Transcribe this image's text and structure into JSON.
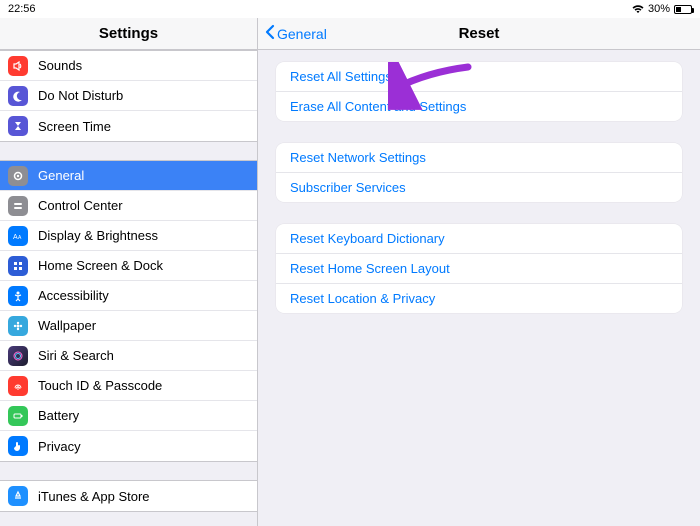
{
  "status": {
    "time": "22:56",
    "battery_pct": "30%"
  },
  "sidebar": {
    "title": "Settings",
    "group1": [
      {
        "label": "Sounds",
        "icon": "sounds",
        "bg": "#ff3b30"
      },
      {
        "label": "Do Not Disturb",
        "icon": "dnd",
        "bg": "#5856d6"
      },
      {
        "label": "Screen Time",
        "icon": "screentime",
        "bg": "#5856d6"
      }
    ],
    "group2": [
      {
        "label": "General",
        "icon": "general",
        "bg": "#8e8e93",
        "selected": true
      },
      {
        "label": "Control Center",
        "icon": "controlcenter",
        "bg": "#8e8e93"
      },
      {
        "label": "Display & Brightness",
        "icon": "display",
        "bg": "#007aff"
      },
      {
        "label": "Home Screen & Dock",
        "icon": "homescreen",
        "bg": "#2d5dd6"
      },
      {
        "label": "Accessibility",
        "icon": "accessibility",
        "bg": "#007aff"
      },
      {
        "label": "Wallpaper",
        "icon": "wallpaper",
        "bg": "#36a8de"
      },
      {
        "label": "Siri & Search",
        "icon": "siri",
        "bg": "#1c1c2e"
      },
      {
        "label": "Touch ID & Passcode",
        "icon": "touchid",
        "bg": "#ff3b30"
      },
      {
        "label": "Battery",
        "icon": "battery",
        "bg": "#34c759"
      },
      {
        "label": "Privacy",
        "icon": "privacy",
        "bg": "#007aff"
      }
    ],
    "group3": [
      {
        "label": "iTunes & App Store",
        "icon": "appstore",
        "bg": "#1e90ff"
      }
    ]
  },
  "detail": {
    "back_label": "General",
    "title": "Reset",
    "section1": [
      "Reset All Settings",
      "Erase All Content and Settings"
    ],
    "section2": [
      "Reset Network Settings",
      "Subscriber Services"
    ],
    "section3": [
      "Reset Keyboard Dictionary",
      "Reset Home Screen Layout",
      "Reset Location & Privacy"
    ]
  }
}
